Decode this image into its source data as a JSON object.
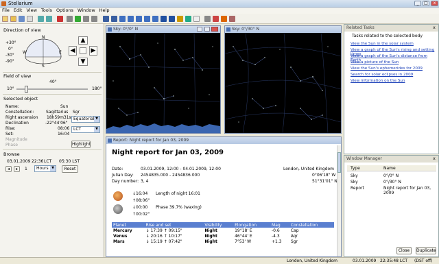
{
  "window": {
    "title": "Stellarium"
  },
  "menu": [
    "File",
    "Edit",
    "View",
    "Tools",
    "Options",
    "Window",
    "Help"
  ],
  "left": {
    "direction_title": "Direction of view",
    "compass": {
      "n": "N",
      "s": "S",
      "e": "E",
      "w": "W",
      "alt_top": "+30°",
      "alt_mid": "0°",
      "alt_low": "-30°",
      "alt_bottom": "-90°"
    },
    "fov_title": "Field of view",
    "fov_value": "40°",
    "fov_min": "10°",
    "fov_max": "180°",
    "fov_level": 0.12,
    "selected_title": "Selected object",
    "fields": [
      {
        "label": "Name:",
        "value": "Sun"
      },
      {
        "label": "Constellation:",
        "value": "Sagittarius",
        "extra": "Sgr"
      },
      {
        "label": "Right ascension",
        "value": "18h59m31s"
      },
      {
        "label": "Declination",
        "value": "-22°44'06\""
      },
      {
        "label": "Rise:",
        "value": "08:06"
      },
      {
        "label": "Set:",
        "value": "16:04"
      },
      {
        "label": "Magnitude",
        "value": ""
      },
      {
        "label": "Phase",
        "value": ""
      }
    ],
    "coord_combo": "Equatorial",
    "time_combo": "LCT",
    "highlight_button": "Highlight",
    "browse_title": "Browse",
    "browse_date": "03.01.2009",
    "browse_time": "22:36",
    "browse_tz": "LCT",
    "browse_lst": "05:30 LST",
    "step_value": "1",
    "step_unit": "Hours",
    "reset_button": "Reset"
  },
  "sky1": {
    "title": "Sky: 0°/0° N"
  },
  "sky2": {
    "title": "Sky: 0°/30° N"
  },
  "report": {
    "caption": "Report: Night report for Jan 03, 2009",
    "heading": "Night report for Jan 03, 2009",
    "date_label": "Date:",
    "date_value": "03.01.2009, 12:00 - 04.01.2009, 12:00",
    "jd_label": "Julian Day:",
    "jd_value": "2454835.000 - 2454836.000",
    "day_label": "Day number:",
    "day_value": "3, 4",
    "location": "London, United Kingdom",
    "longitude": "0°06'18\" W",
    "latitude": "51°31'01\" N",
    "sun_set": "↓16:04",
    "sun_rise": "↑08:06\"",
    "night_length": "Length of night 16:01",
    "moon_set": "↓00:00",
    "moon_rise": "↑00:02\"",
    "moon_phase": "Phase 39.7% (waxing)",
    "table": {
      "headers": [
        "Planet",
        "Rise and set",
        "Visibility",
        "Elongation",
        "Mag",
        "Constellation"
      ],
      "rows": [
        [
          "Mercury",
          "↓ 17:39   ↑ 09:15\"",
          "Night",
          "19°18' E",
          "-0.6",
          "Cap"
        ],
        [
          "Venus",
          "↓ 20:16   ↑ 10:17\"",
          "Night",
          "46°44' E",
          "-4.3",
          "Aqr"
        ],
        [
          "Mars",
          "↓ 15:19   ↑ 07:42\"",
          "Night",
          "7°53' W",
          "+1.3",
          "Sgr"
        ]
      ]
    }
  },
  "tasks": {
    "title": "Related Tasks",
    "subtitle": "Tasks related to the selected body",
    "links": [
      "View the Sun in the solar system",
      "View a graph of the Sun's rising and setting times",
      "View a graph of the Sun's distance from Earth",
      "View a picture of the Sun",
      "View the Sun's ephemerides for 2009",
      "Search for solar eclipses in 2009",
      "View information on the Sun"
    ]
  },
  "wm": {
    "title": "Window Manager",
    "col_type": "Type",
    "col_name": "Name",
    "rows": [
      {
        "type": "Sky",
        "name": "0°/0° N"
      },
      {
        "type": "Sky",
        "name": "0°/30° N"
      },
      {
        "type": "Report",
        "name": "Night report for Jan 03, 2009"
      }
    ],
    "close_button": "Close",
    "duplicate_button": "Duplicate"
  },
  "status": {
    "location": "London, United Kingdom",
    "date": "03.01.2009",
    "time": "22:35:48 LCT",
    "dst": "(DST off)"
  },
  "colors": {
    "accent": "#5a7fd0",
    "link": "#1a3fb8",
    "sky": "#000000"
  }
}
